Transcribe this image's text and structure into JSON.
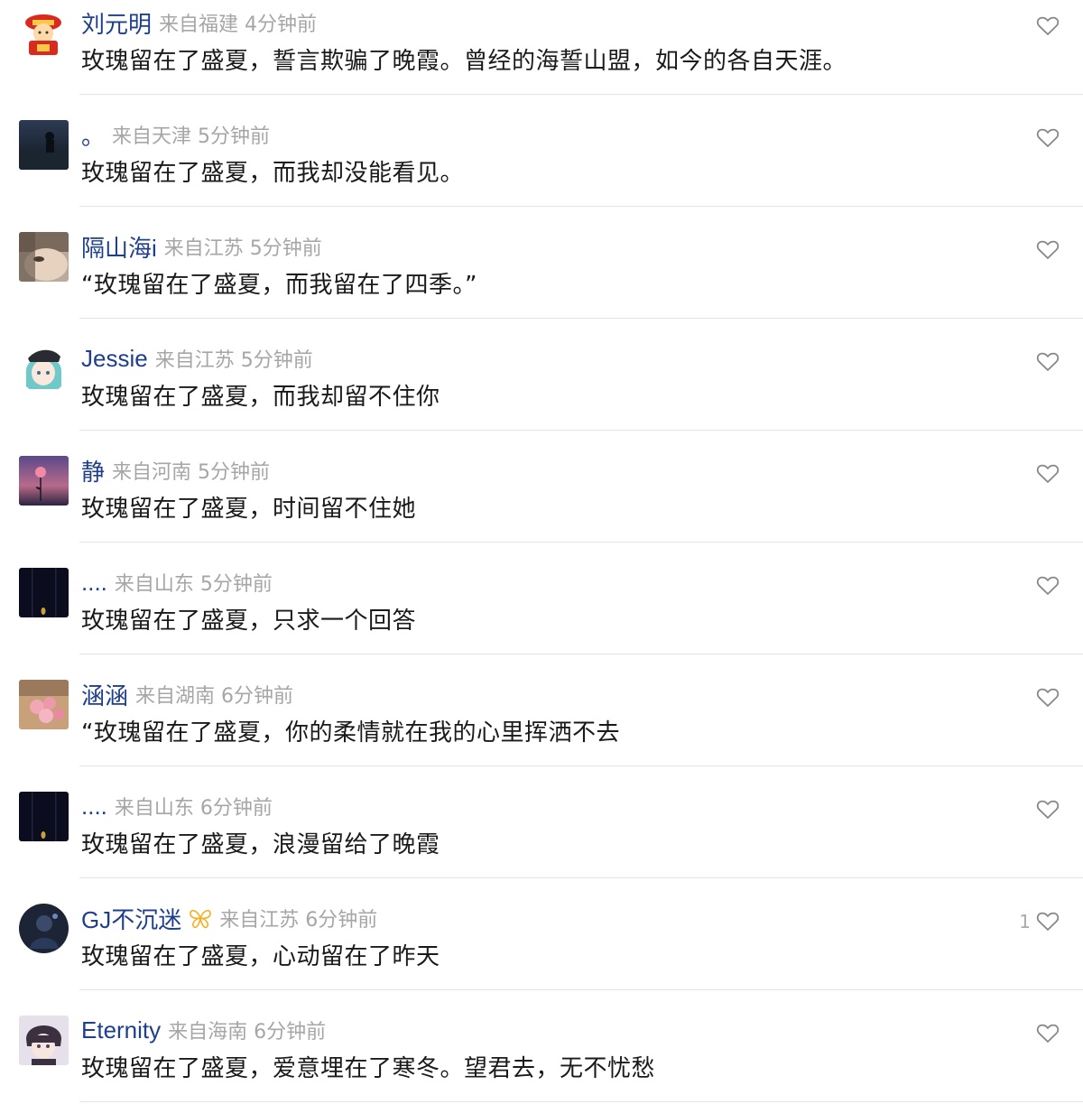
{
  "comments": [
    {
      "username": "刘元明",
      "source": "来自福建 4分钟前",
      "text": "玫瑰留在了盛夏，誓言欺骗了晚霞。曾经的海誓山盟，如今的各自天涯。",
      "likes": ""
    },
    {
      "username": "。",
      "source": "来自天津 5分钟前",
      "text": "玫瑰留在了盛夏，而我却没能看见。",
      "likes": ""
    },
    {
      "username": "隔山海i",
      "source": "来自江苏 5分钟前",
      "text": "“玫瑰留在了盛夏，而我留在了四季。”",
      "likes": ""
    },
    {
      "username": "Jessie",
      "source": "来自江苏 5分钟前",
      "text": "玫瑰留在了盛夏，而我却留不住你",
      "likes": ""
    },
    {
      "username": "静",
      "source": "来自河南 5分钟前",
      "text": "玫瑰留在了盛夏，时间留不住她",
      "likes": ""
    },
    {
      "username": "....",
      "source": "来自山东 5分钟前",
      "text": "玫瑰留在了盛夏，只求一个回答",
      "likes": ""
    },
    {
      "username": "涵涵",
      "source": "来自湖南 6分钟前",
      "text": "“玫瑰留在了盛夏，你的柔情就在我的心里挥洒不去",
      "likes": ""
    },
    {
      "username": "....",
      "source": "来自山东 6分钟前",
      "text": "玫瑰留在了盛夏，浪漫留给了晚霞",
      "likes": ""
    },
    {
      "username": "GJ不沉迷",
      "source": "来自江苏 6分钟前",
      "text": "玫瑰留在了盛夏，心动留在了昨天",
      "likes": "1"
    },
    {
      "username": "Eternity",
      "source": "来自海南 6分钟前",
      "text": "玫瑰留在了盛夏，爱意埋在了寒冬。望君去，无不忧愁",
      "likes": ""
    }
  ],
  "colors": {
    "username": "#1f3f8c",
    "meta": "#a6a6a6",
    "text": "#1a1a1a",
    "divider": "#e4e4e4",
    "heart": "#888888",
    "badge": "#f2b01e"
  }
}
